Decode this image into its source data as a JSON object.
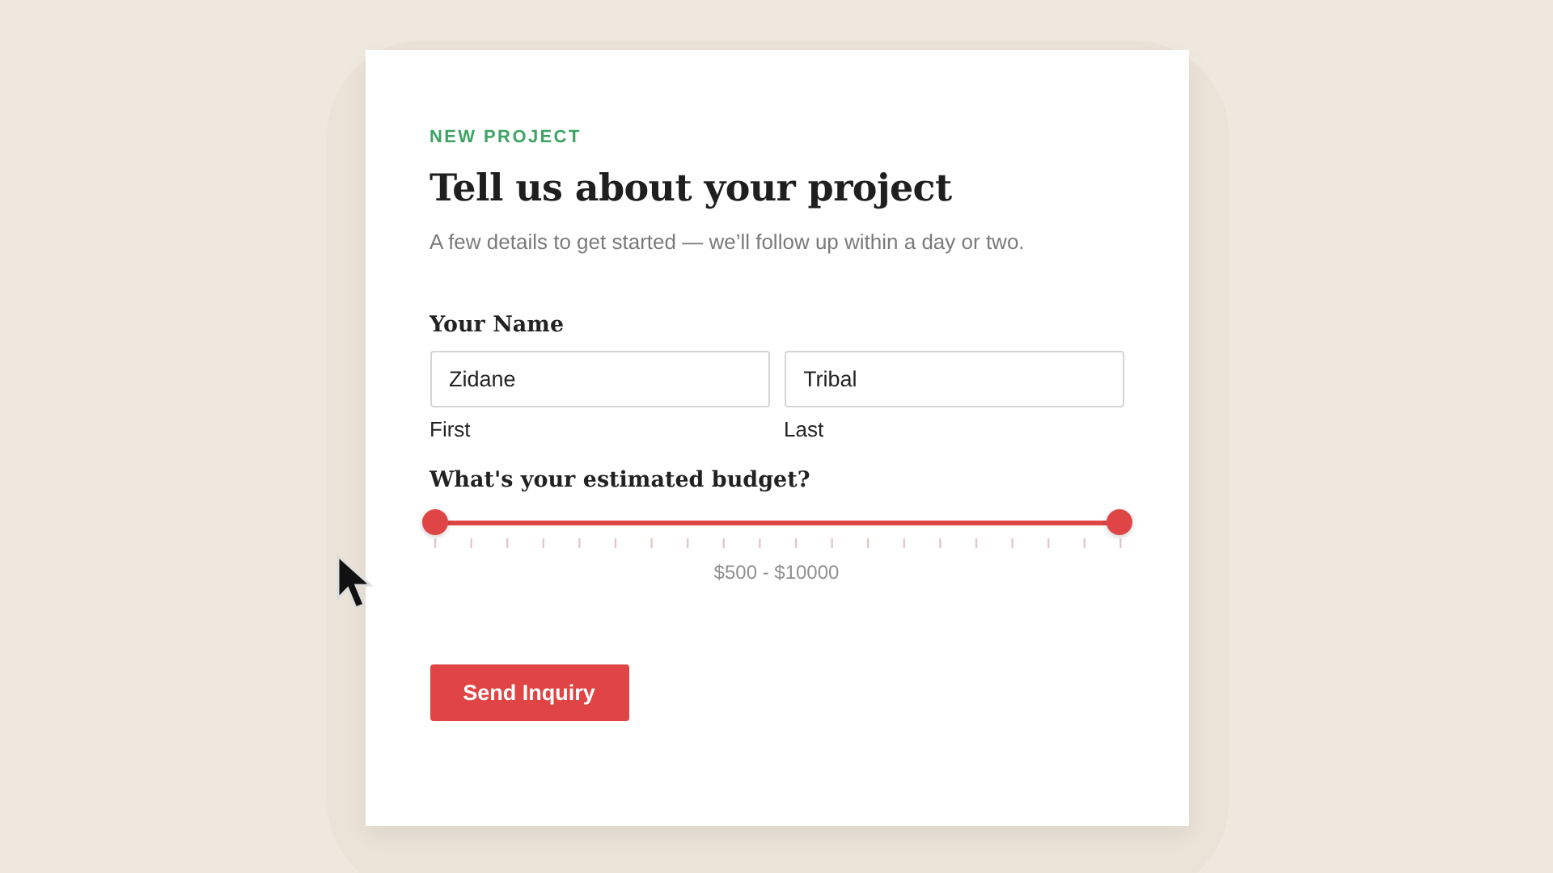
{
  "eyebrow": "NEW PROJECT",
  "title": "Tell us about your project",
  "subtitle": "A few details to get started — we’ll follow up within a day or two.",
  "name_group": {
    "label": "Your Name",
    "fields": [
      {
        "value": "Zidane",
        "caption": "First"
      },
      {
        "value": "Tribal",
        "caption": "Last"
      }
    ]
  },
  "budget": {
    "label": "What's your estimated budget?",
    "handles": [
      {
        "level": 0
      },
      {
        "level": 1
      }
    ],
    "reading": "$500 - $10000"
  },
  "submit_button": "Send Inquiry"
}
